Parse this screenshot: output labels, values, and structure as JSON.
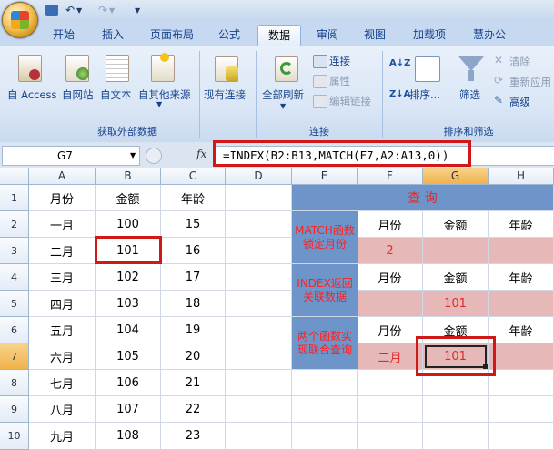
{
  "qat": {
    "undo": "↶",
    "redo": "↷",
    "more": "▼"
  },
  "tabs": [
    "开始",
    "插入",
    "页面布局",
    "公式",
    "数据",
    "审阅",
    "视图",
    "加载项",
    "慧办公"
  ],
  "active_tab": "数据",
  "ribbon": {
    "external": {
      "access": "自 Access",
      "web": "自网站",
      "text": "自文本",
      "other": "自其他来源",
      "existing": "现有连接",
      "label": "获取外部数据"
    },
    "connections": {
      "refresh": "全部刷新",
      "conn": "连接",
      "props": "属性",
      "edit_links": "编辑链接",
      "label": "连接"
    },
    "sort": {
      "az": "A↓Z",
      "za": "Z↓A",
      "sort": "排序...",
      "filter": "筛选",
      "clear": "清除",
      "reapply": "重新应用",
      "advanced": "高级",
      "label": "排序和筛选"
    }
  },
  "formula_bar": {
    "name_box": "G7",
    "fx": "fx",
    "formula": "=INDEX(B2:B13,MATCH(F7,A2:A13,0))"
  },
  "columns": [
    "A",
    "B",
    "C",
    "D",
    "E",
    "F",
    "G",
    "H"
  ],
  "rows": [
    "1",
    "2",
    "3",
    "4",
    "5",
    "6",
    "7",
    "8",
    "9",
    "10"
  ],
  "table": {
    "headers": [
      "月份",
      "金额",
      "年龄"
    ],
    "data": [
      [
        "一月",
        "100",
        "15"
      ],
      [
        "二月",
        "101",
        "16"
      ],
      [
        "三月",
        "102",
        "17"
      ],
      [
        "四月",
        "103",
        "18"
      ],
      [
        "五月",
        "104",
        "19"
      ],
      [
        "六月",
        "105",
        "20"
      ],
      [
        "七月",
        "106",
        "21"
      ],
      [
        "八月",
        "107",
        "22"
      ],
      [
        "九月",
        "108",
        "23"
      ]
    ]
  },
  "query": {
    "title": "查 询",
    "labels": [
      "MATCH函数锁定月份",
      "INDEX返回关联数据",
      "两个函数实现联合查询"
    ],
    "sub_headers": [
      "月份",
      "金额",
      "年龄"
    ],
    "match_result": "2",
    "index_result": "101",
    "combo_month": "二月",
    "combo_result": "101"
  },
  "colors": {
    "accent_red": "#d01818",
    "blue_fill": "#6d95c9",
    "pink_fill": "#e6b9b8"
  }
}
